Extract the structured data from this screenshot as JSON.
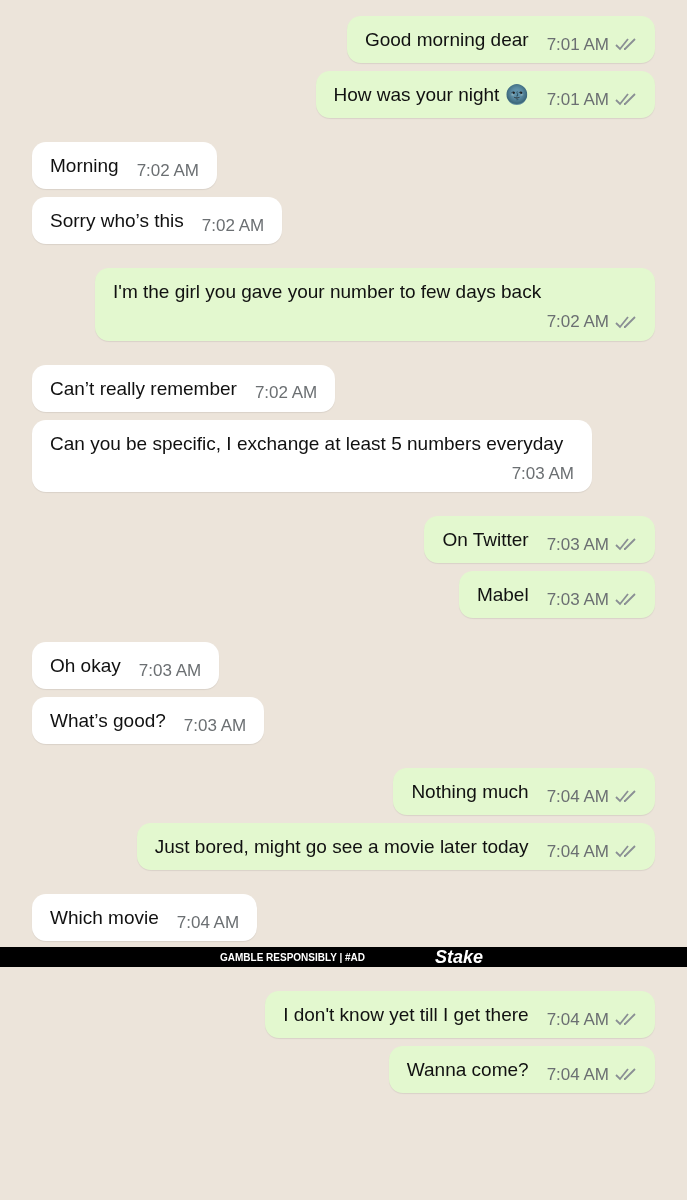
{
  "messages": [
    {
      "kind": "outgoing",
      "text": "Good morning dear",
      "time": "7:01 AM",
      "read": false
    },
    {
      "kind": "outgoing",
      "text": "How was your night 🌚",
      "time": "7:01 AM",
      "read": false
    },
    {
      "kind": "incoming",
      "text": "Morning",
      "time": "7:02 AM"
    },
    {
      "kind": "incoming",
      "text": "Sorry who’s this",
      "time": "7:02 AM"
    },
    {
      "kind": "outgoing",
      "text": "I'm the girl you gave your number to few days back",
      "time": "7:02 AM",
      "read": false
    },
    {
      "kind": "incoming",
      "text": "Can’t really remember",
      "time": "7:02 AM"
    },
    {
      "kind": "incoming",
      "text": "Can you be specific, I exchange at least 5 numbers everyday",
      "time": "7:03 AM"
    },
    {
      "kind": "outgoing",
      "text": "On Twitter",
      "time": "7:03 AM",
      "read": false
    },
    {
      "kind": "outgoing",
      "text": "Mabel",
      "time": "7:03 AM",
      "read": false
    },
    {
      "kind": "incoming",
      "text": "Oh okay",
      "time": "7:03 AM"
    },
    {
      "kind": "incoming",
      "text": "What’s good?",
      "time": "7:03 AM"
    },
    {
      "kind": "outgoing",
      "text": "Nothing much",
      "time": "7:04 AM",
      "read": false
    },
    {
      "kind": "outgoing",
      "text": "Just bored, might go see a movie later today",
      "time": "7:04 AM",
      "read": false
    },
    {
      "kind": "incoming",
      "text": "Which movie",
      "time": "7:04 AM"
    }
  ],
  "ad_banner": {
    "notice": "GAMBLE RESPONSIBLY | #AD",
    "logo": "Stake"
  },
  "messages_after": [
    {
      "kind": "outgoing",
      "text": "I don't know yet till I get there",
      "time": "7:04 AM",
      "read": false
    },
    {
      "kind": "outgoing",
      "text": "Wanna come?",
      "time": "7:04 AM",
      "read": false
    }
  ]
}
